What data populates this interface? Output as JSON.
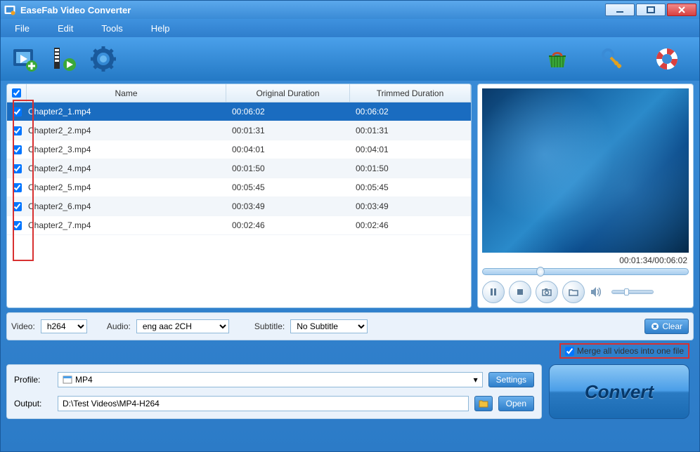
{
  "window": {
    "title": "EaseFab Video Converter"
  },
  "menu": {
    "file": "File",
    "edit": "Edit",
    "tools": "Tools",
    "help": "Help"
  },
  "table": {
    "headers": {
      "name": "Name",
      "original": "Original Duration",
      "trimmed": "Trimmed Duration"
    },
    "rows": [
      {
        "checked": true,
        "selected": true,
        "name": "Chapter2_1.mp4",
        "original": "00:06:02",
        "trimmed": "00:06:02"
      },
      {
        "checked": true,
        "selected": false,
        "name": "Chapter2_2.mp4",
        "original": "00:01:31",
        "trimmed": "00:01:31"
      },
      {
        "checked": true,
        "selected": false,
        "name": "Chapter2_3.mp4",
        "original": "00:04:01",
        "trimmed": "00:04:01"
      },
      {
        "checked": true,
        "selected": false,
        "name": "Chapter2_4.mp4",
        "original": "00:01:50",
        "trimmed": "00:01:50"
      },
      {
        "checked": true,
        "selected": false,
        "name": "Chapter2_5.mp4",
        "original": "00:05:45",
        "trimmed": "00:05:45"
      },
      {
        "checked": true,
        "selected": false,
        "name": "Chapter2_6.mp4",
        "original": "00:03:49",
        "trimmed": "00:03:49"
      },
      {
        "checked": true,
        "selected": false,
        "name": "Chapter2_7.mp4",
        "original": "00:02:46",
        "trimmed": "00:02:46"
      }
    ]
  },
  "preview": {
    "time": "00:01:34/00:06:02",
    "seek_percent": 26
  },
  "options": {
    "video_label": "Video:",
    "video_value": "h264",
    "audio_label": "Audio:",
    "audio_value": "eng aac 2CH",
    "subtitle_label": "Subtitle:",
    "subtitle_value": "No Subtitle",
    "clear_label": "Clear",
    "merge_label": "Merge all videos into one file",
    "merge_checked": true
  },
  "profile": {
    "label": "Profile:",
    "value": "MP4",
    "settings_label": "Settings"
  },
  "output": {
    "label": "Output:",
    "path": "D:\\Test Videos\\MP4-H264",
    "open_label": "Open"
  },
  "convert": {
    "label": "Convert"
  }
}
